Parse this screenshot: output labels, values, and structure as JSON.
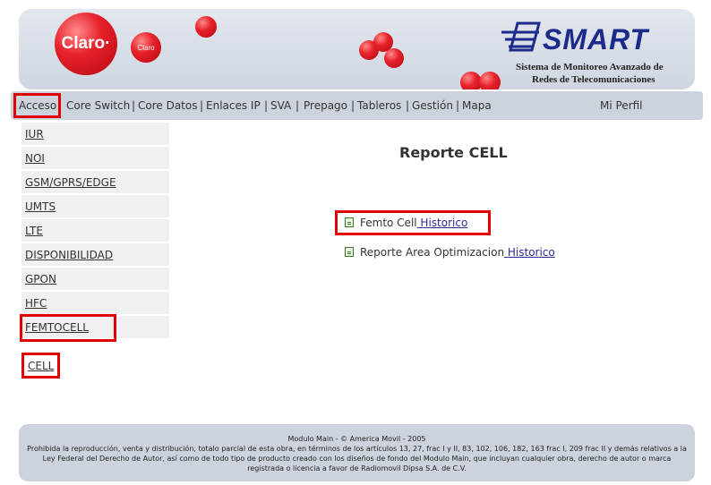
{
  "header": {
    "claro_logo_text": "Claro·",
    "claro_small_text": "Claro",
    "smart_title": "SMART",
    "smart_subtitle_line1": "Sistema de Monitoreo Avanzado de",
    "smart_subtitle_line2": "Redes de Telecomunicaciones"
  },
  "nav": {
    "items": [
      "Acceso",
      "Core Switch",
      "Core Datos",
      "Enlaces IP",
      "SVA",
      "Prepago",
      "Tableros",
      "Gestión",
      "Mapa"
    ],
    "separator": "|",
    "profile": "Mi Perfil"
  },
  "sidebar": {
    "items": [
      "IUR",
      "NOI",
      "GSM/GPRS/EDGE",
      "UMTS",
      "LTE",
      "DISPONIBILIDAD",
      "GPON",
      "HFC",
      "FEMTOCELL"
    ],
    "cell": "CELL"
  },
  "main": {
    "title": "Reporte CELL",
    "reports": [
      {
        "label": "Femto Cell",
        "link": " Historico"
      },
      {
        "label": "Reporte Area Optimizacion",
        "link": " Historico"
      }
    ]
  },
  "footer": {
    "line1": "Modulo Main - © America Movil - 2005",
    "line2": "Prohibida la reproducción, venta y distribución, totalo parcial de esta obra, en términos de los artículos 13, 27, frac I y II, 83, 102, 106, 182, 163 frac I, 209 frac II y demás relativos a la Ley Federal del Derecho de Autor, así como de todo tipo de producto creado con los diseños de fondo del Modulo Main, que incluyan cualquier obra, derecho de autor o marca registrada o licencia a favor de Radiomovil Dipsa S.A. de C.V."
  },
  "colors": {
    "highlight": "#e00000",
    "brand_red": "#e8222b",
    "smart_blue": "#1c2a8a"
  }
}
